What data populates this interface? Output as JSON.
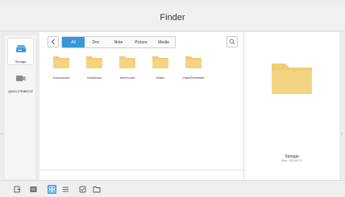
{
  "window": {
    "title": "Finder"
  },
  "sidebar": {
    "items": [
      {
        "label": "Storage",
        "icon": "storage-drive-icon",
        "active": true
      },
      {
        "label": "QINGCPRIBROE",
        "icon": "usb-drive-icon",
        "active": false
      }
    ]
  },
  "toolbar": {
    "back_icon": "chevron-left-icon",
    "filters": [
      "All",
      "Doc",
      "Note",
      "Picture",
      "Media"
    ],
    "active_filter": "All",
    "search_icon": "search-icon"
  },
  "files": [
    {
      "name": "Documents",
      "icon": "folder-icon"
    },
    {
      "name": "Download",
      "icon": "folder-icon"
    },
    {
      "name": "lost+found",
      "icon": "folder-icon"
    },
    {
      "name": "Notes",
      "icon": "folder-icon"
    },
    {
      "name": "VideoPresenter",
      "icon": "folder-icon"
    }
  ],
  "detail": {
    "title": "Storage",
    "subtitle": "Time: 2019/07/17"
  },
  "bottom_toolbar": {
    "buttons": [
      {
        "icon": "exit-icon"
      },
      {
        "icon": "panel-icon"
      },
      {
        "icon": "grid-view-icon",
        "active": true
      },
      {
        "icon": "list-view-icon"
      },
      {
        "icon": "select-checkbox-icon"
      },
      {
        "icon": "new-folder-icon"
      }
    ]
  },
  "colors": {
    "accent": "#3a97d8",
    "folder": "#f0cd75",
    "background": "#ececec"
  }
}
